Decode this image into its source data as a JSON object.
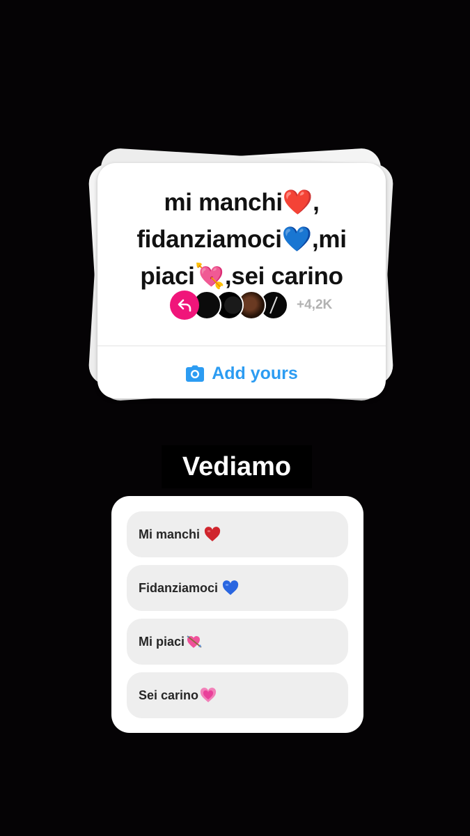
{
  "sticker": {
    "prompt_line1": "mi manchi❤️,",
    "prompt_line2": "fidanziamoci💙,mi",
    "prompt_line3": "piaci💘,sei carino",
    "participant_count": "+4,2K",
    "action_label": "Add yours",
    "action_color": "#2c9cf2",
    "badge_color": "#f0157a"
  },
  "label": {
    "text": "Vediamo"
  },
  "poll": {
    "options": [
      {
        "text": "Mi manchi",
        "emoji": "red-heart-icon"
      },
      {
        "text": "Fidanziamoci",
        "emoji": "blue-heart-icon"
      },
      {
        "text": "Mi piaci",
        "emoji": "heart-with-arrow-icon"
      },
      {
        "text": "Sei carino",
        "emoji": "growing-heart-icon"
      }
    ]
  }
}
